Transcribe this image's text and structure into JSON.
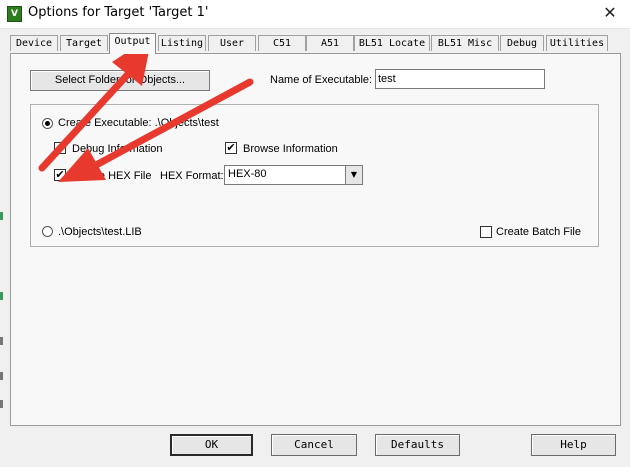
{
  "window": {
    "app_icon_glyph": "V",
    "title": "Options for Target 'Target 1'",
    "close_glyph": "✕"
  },
  "tabs": [
    {
      "label": "Device"
    },
    {
      "label": "Target"
    },
    {
      "label": "Output",
      "active": true
    },
    {
      "label": "Listing"
    },
    {
      "label": "User"
    },
    {
      "label": "C51"
    },
    {
      "label": "A51"
    },
    {
      "label": "BL51 Locate"
    },
    {
      "label": "BL51 Misc"
    },
    {
      "label": "Debug"
    },
    {
      "label": "Utilities"
    }
  ],
  "output": {
    "select_folder_label": "Select Folder for Objects...",
    "name_of_executable_label": "Name of Executable:",
    "name_of_executable_value": "test",
    "create_executable_label": "Create Executable:  .\\Objects\\test",
    "create_executable_selected": true,
    "debug_information_label": "Debug Information",
    "debug_information_checked": true,
    "browse_information_label": "Browse Information",
    "browse_information_checked": true,
    "create_hex_label": "Create HEX File",
    "create_hex_checked": true,
    "hex_format_label": "HEX Format:",
    "hex_format_value": "HEX-80",
    "create_library_label": ".\\Objects\\test.LIB",
    "create_library_selected": false,
    "create_batch_label": "Create Batch File",
    "create_batch_checked": false
  },
  "footer": {
    "ok_label": "OK",
    "cancel_label": "Cancel",
    "defaults_label": "Defaults",
    "help_label": "Help"
  },
  "annotation": {
    "arrow_color": "#e8392e",
    "arrows": [
      "arrow to Output tab",
      "arrow to Create HEX File checkbox"
    ]
  },
  "colors": {
    "window_bg": "#f0f0f0",
    "panel_bg": "#f8f8f8",
    "check_mark": "✔"
  }
}
